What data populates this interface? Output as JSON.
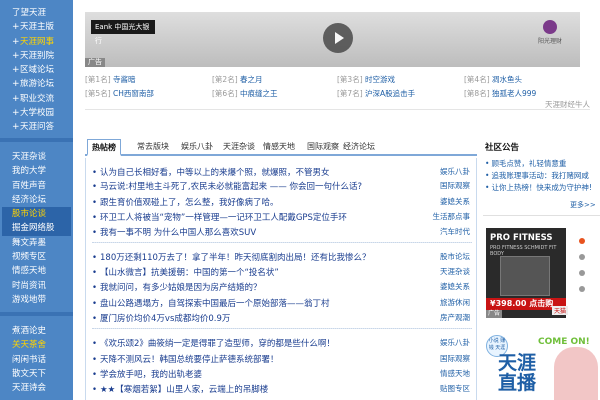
{
  "sidebar": {
    "groups": [
      [
        "了望天涯",
        "天涯主版",
        "天涯网事",
        "天涯别院",
        "区域论坛",
        "旅游论坛",
        "职业交流",
        "大学校园",
        "天涯问答"
      ],
      [
        "天涯杂谈",
        "我的大学",
        "百姓声音",
        "经济论坛",
        "股市论谈",
        "掘金网络股",
        "舞文弄墨",
        "视频专区",
        "情感天地",
        "时尚资讯",
        "游戏地带"
      ],
      [
        "煮酒论史",
        "关天茶舍",
        "闲闲书话",
        "散文天下",
        "天涯诗会"
      ]
    ],
    "active": [
      "天涯网事",
      "股市论谈",
      "关天茶舍"
    ],
    "highlight": [
      "股市论谈",
      "掘金网络股"
    ],
    "plus_items": [
      "天涯主版",
      "天涯网事",
      "天涯别院",
      "区域论坛",
      "旅游论坛",
      "职业交流",
      "大学校园",
      "天涯问答"
    ]
  },
  "banner": {
    "bank_logo": "Eank 中国光大银行",
    "right_brand": "阳光理财",
    "ad_tag": "广告"
  },
  "ranks": [
    [
      {
        "rank": "[第1名]",
        "title": "寺酱暗"
      },
      {
        "rank": "[第2名]",
        "title": "春之月"
      },
      {
        "rank": "[第3名]",
        "title": "时空游戏"
      },
      {
        "rank": "[第4名]",
        "title": "凋水鱼头"
      }
    ],
    [
      {
        "rank": "[第5名]",
        "title": "CH西窗南部"
      },
      {
        "rank": "[第6名]",
        "title": "中痕缝之王"
      },
      {
        "rank": "[第7名]",
        "title": "沪深A股追击手"
      },
      {
        "rank": "[第8名]",
        "title": "独孤老人999"
      }
    ]
  ],
  "rank_more": "天涯财经牛人",
  "tabs": [
    "热帖榜",
    "常去版块",
    "娱乐八卦",
    "天涯杂谈",
    "情感天地",
    "国际观察",
    "经济论坛"
  ],
  "posts": [
    {
      "title": "认为自己长相好看，中等以上的来爆个照，就爆照，不管男女",
      "board": "娱乐八卦"
    },
    {
      "title": "马云说:村里地主斗死了,农民未必就能富起来 —— 你会回一句什么话?",
      "board": "国际观察"
    },
    {
      "title": "跟生育价值观碰上了，怎么整，我好像病了哈。",
      "board": "婆媳关系"
    },
    {
      "title": "环卫工人将被当“宠物”一样管理—一记环卫工人配戴GPS定位手环",
      "board": "生活那点事"
    },
    {
      "title": "我有一事不明 为什么中国人那么喜欢SUV",
      "board": "汽车时代"
    },
    {
      "title": "180万还剩110万去了！拿了半年！昨天彻底割肉出局！还有比我惨么？",
      "board": "股市论坛"
    },
    {
      "title": "【山水微言】抗美援朝：中国的第一个“投名状”",
      "board": "天涯杂谈"
    },
    {
      "title": "我就问问，有多少姑娘是因为房产结婚的？",
      "board": "婆媳关系"
    },
    {
      "title": "盘山公路遇塌方，自驾探索中国最后一个原始部落——翁丁村",
      "board": "旅游休闲"
    },
    {
      "title": "厦门房价均价4万vs成都均价0.9万",
      "board": "房产观潮"
    },
    {
      "title": "《欢乐颂2》曲筱绡一定是得罪了造型师，穿的都是些什么啊！",
      "board": "娱乐八卦"
    },
    {
      "title": "天降不测风云！韩国总统要停止萨德系统部署！",
      "board": "国际观察"
    },
    {
      "title": "学会放手吧，我的出轨老婆",
      "board": "情感天地"
    },
    {
      "title": "★★【寒烟若絮】山里人家，云端上的吊脚楼",
      "board": "贴图专区"
    }
  ],
  "community": {
    "title": "社区公告",
    "notices": [
      "顾毛点赞，礼轻情意重",
      "追我账理事活动：我打赌网咸",
      "让你上热榜！快来成为守护神!"
    ],
    "more": "更多>>"
  },
  "ad1": {
    "headline": "PRO FITNESS",
    "sub": "PRO FITNESS SCHMIDT FIT BODY",
    "price": "¥398.00 点击购",
    "brand": "天猫",
    "ad_tag": "广告"
  },
  "ad2": {
    "circle_text": "小说 赚钱 天涯",
    "come_on": "COME ON!",
    "big_text": "天涯直播"
  }
}
